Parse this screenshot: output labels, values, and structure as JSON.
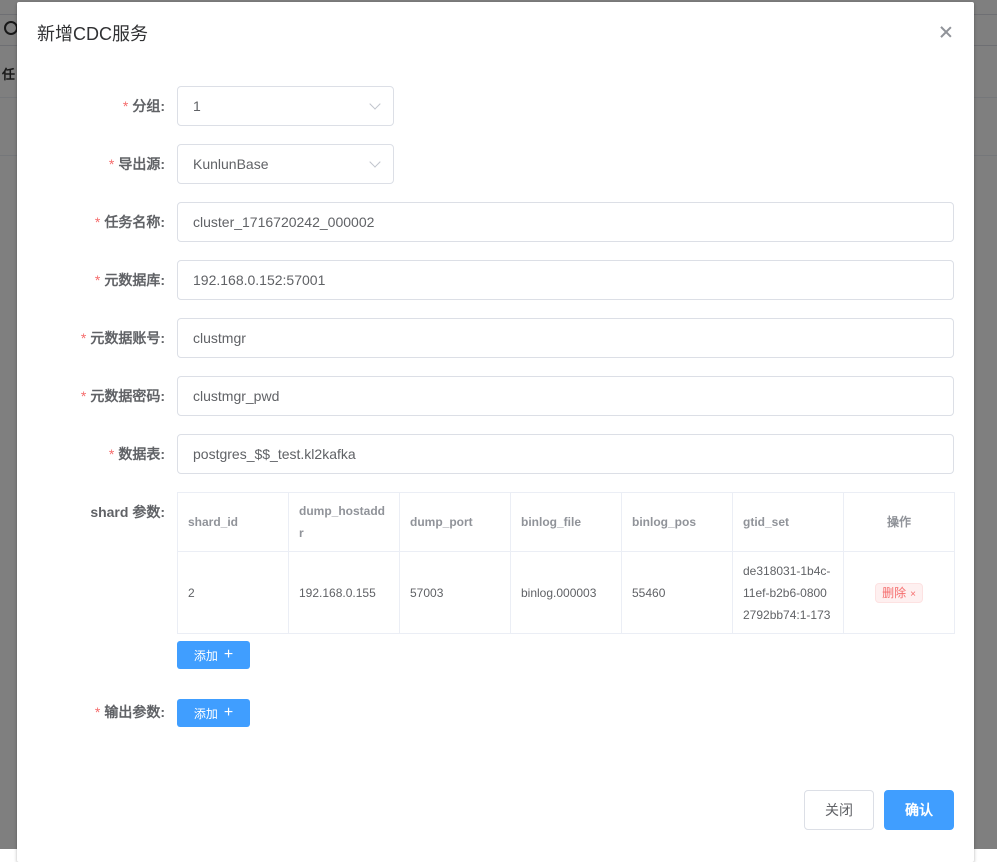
{
  "background": {
    "row_label": "任"
  },
  "dialog": {
    "title": "新增CDC服务"
  },
  "form": {
    "group": {
      "label": "分组:",
      "value": "1"
    },
    "source": {
      "label": "导出源:",
      "value": "KunlunBase"
    },
    "task_name": {
      "label": "任务名称:",
      "value": "cluster_1716720242_000002"
    },
    "meta_db": {
      "label": "元数据库:",
      "value": "192.168.0.152:57001"
    },
    "meta_user": {
      "label": "元数据账号:",
      "value": "clustmgr"
    },
    "meta_password": {
      "label": "元数据密码:",
      "value": "clustmgr_pwd"
    },
    "data_table": {
      "label": "数据表:",
      "value": "postgres_$$_test.kl2kafka"
    },
    "shard": {
      "label": "shard 参数:",
      "columns": [
        "shard_id",
        "dump_hostaddr",
        "dump_port",
        "binlog_file",
        "binlog_pos",
        "gtid_set",
        "操作"
      ],
      "rows": [
        {
          "shard_id": "2",
          "dump_hostaddr": "192.168.0.155",
          "dump_port": "57003",
          "binlog_file": "binlog.000003",
          "binlog_pos": "55460",
          "gtid_set": "de318031-1b4c-11ef-b2b6-08002792bb74:1-173",
          "delete_label": "删除",
          "delete_x": "×"
        }
      ],
      "add_label": "添加"
    },
    "output": {
      "label": "输出参数:",
      "add_label": "添加"
    }
  },
  "footer": {
    "close_label": "关闭",
    "confirm_label": "确认"
  }
}
